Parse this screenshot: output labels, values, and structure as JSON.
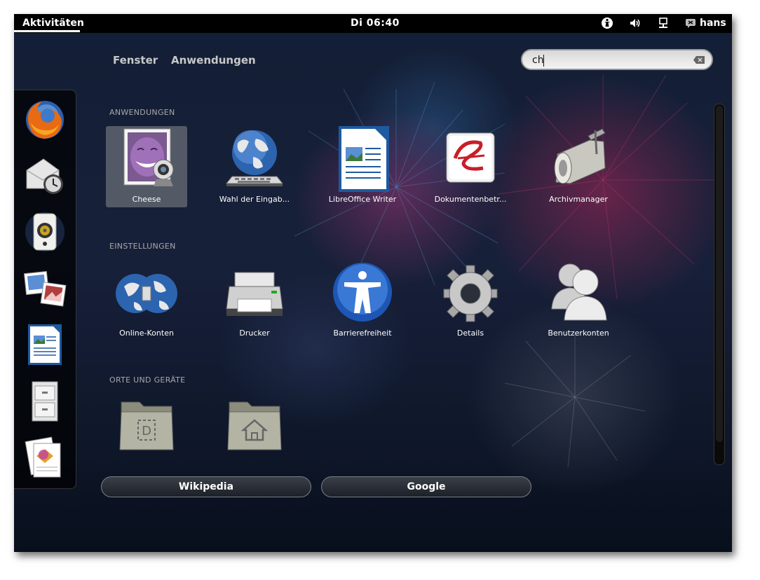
{
  "topbar": {
    "activities_label": "Aktivitäten",
    "clock": "Di 06:40",
    "status_icons": [
      "accessibility-icon",
      "volume-icon",
      "network-icon",
      "user-status-icon"
    ],
    "user_name": "hans"
  },
  "view_tabs": [
    "Fenster",
    "Anwendungen"
  ],
  "search": {
    "value": "ch"
  },
  "dash": {
    "items": [
      "firefox-icon",
      "evolution-mail-icon",
      "rhythmbox-icon",
      "shotwell-icon",
      "libreoffice-writer-icon",
      "file-manager-icon",
      "office-docs-icon"
    ]
  },
  "sections": {
    "applications": {
      "header": "ANWENDUNGEN",
      "items": [
        {
          "label": "Cheese",
          "icon": "cheese-icon",
          "selected": true
        },
        {
          "label": "Wahl der Eingab...",
          "icon": "globe-keyboard-icon"
        },
        {
          "label": "LibreOffice Writer",
          "icon": "libreoffice-writer-icon"
        },
        {
          "label": "Dokumentenbetr...",
          "icon": "evince-document-viewer-icon"
        },
        {
          "label": "Archivmanager",
          "icon": "archive-manager-icon"
        }
      ]
    },
    "settings": {
      "header": "EINSTELLUNGEN",
      "items": [
        {
          "label": "Online-Konten",
          "icon": "online-accounts-icon"
        },
        {
          "label": "Drucker",
          "icon": "printer-icon"
        },
        {
          "label": "Barrierefreiheit",
          "icon": "accessibility-icon"
        },
        {
          "label": "Details",
          "icon": "gear-icon"
        },
        {
          "label": "Benutzerkonten",
          "icon": "users-icon"
        }
      ]
    },
    "places": {
      "header": "ORTE UND GERÄTE",
      "items": [
        {
          "label": "",
          "icon": "documents-folder-icon"
        },
        {
          "label": "",
          "icon": "home-folder-icon"
        }
      ]
    }
  },
  "search_providers": [
    "Wikipedia",
    "Google"
  ],
  "colors": {
    "topbar": "#000000",
    "label": "#ffffff",
    "section_header": "#a8a8a8",
    "selection": "#8c8c8c"
  }
}
